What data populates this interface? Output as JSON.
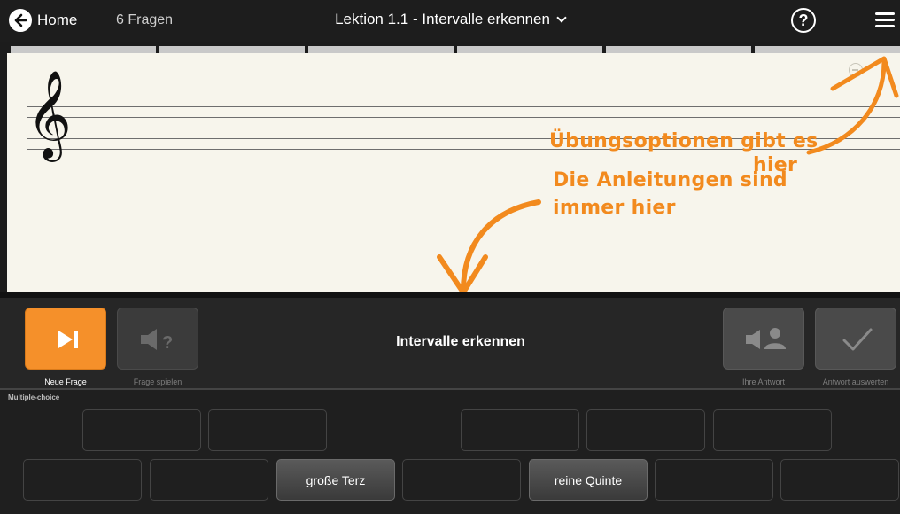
{
  "header": {
    "home_label": "Home",
    "question_count": "6 Fragen",
    "lesson_title": "Lektion 1.1 - Intervalle erkennen",
    "help_glyph": "?"
  },
  "annotations": {
    "options_line1": "Übungsoptionen gibt es",
    "options_line2": "hier",
    "instructions_line1": "Die Anleitungen sind",
    "instructions_line2": "immer hier"
  },
  "toolbar": {
    "new_question_label": "Neue Frage",
    "play_question_label": "Frage spielen",
    "title": "Intervalle erkennen",
    "your_answer_label": "Ihre Antwort",
    "evaluate_label": "Antwort auswerten"
  },
  "answers": {
    "section_label": "Multiple-choice",
    "major_third": "große Terz",
    "perfect_fifth": "reine Quinte"
  },
  "colors": {
    "accent": "#f28a1e",
    "primary_button": "#f5902a",
    "paper": "#f7f5ec"
  },
  "icons": [
    "back-arrow-icon",
    "chevron-down-icon",
    "help-icon",
    "menu-icon",
    "zoom-out-icon",
    "treble-clef-icon",
    "next-icon",
    "speaker-question-icon",
    "speaker-person-icon",
    "checkmark-icon",
    "arrow-icon"
  ]
}
